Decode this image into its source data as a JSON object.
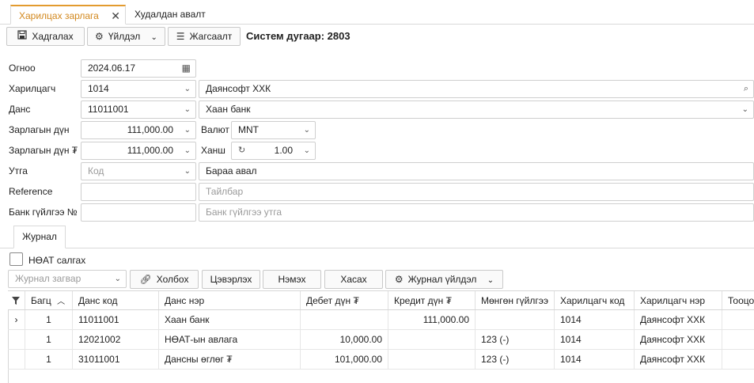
{
  "tabs": [
    {
      "label": "Харилцах зарлага",
      "active": true
    },
    {
      "label": "Худалдан авалт",
      "active": false
    }
  ],
  "toolbar": {
    "save_label": "Хадгалах",
    "action_label": "Үйлдэл",
    "list_label": "Жагсаалт",
    "system_number": "Систем дугаар: 2803"
  },
  "form": {
    "date_label": "Огноо",
    "date_value": "2024.06.17",
    "partner_label": "Харилцагч",
    "partner_code": "1014",
    "partner_name": "Даянсофт ХХК",
    "account_label": "Данс",
    "account_code": "11011001",
    "account_name": "Хаан банк",
    "amount_label": "Зарлагын дүн",
    "amount_value": "111,000.00",
    "currency_label": "Валют",
    "currency_value": "MNT",
    "amount_mnt_label": "Зарлагын дүн ₮",
    "amount_mnt_value": "111,000.00",
    "rate_label": "Ханш",
    "rate_value": "1.00",
    "purpose_label": "Утга",
    "purpose_code_placeholder": "Код",
    "purpose_value": "Бараа авал",
    "reference_label": "Reference",
    "reference_value": "",
    "note_placeholder": "Тайлбар",
    "bank_tx_label": "Банк гүйлгээ №",
    "bank_tx_value": "",
    "bank_tx_placeholder": "Банк гүйлгээ утга"
  },
  "journal": {
    "tab_label": "Журнал",
    "vat_checkbox_label": "НӨАТ салгах",
    "template_placeholder": "Журнал загвар",
    "link_label": "Холбох",
    "clear_label": "Цэвэрлэх",
    "add_label": "Нэмэх",
    "remove_label": "Хасах",
    "journal_action_label": "Журнал үйлдэл",
    "columns": [
      "Багц",
      "Данс код",
      "Данс нэр",
      "Дебет дүн ₮",
      "Кредит дүн ₮",
      "Мөнгөн гүйлгээ",
      "Харилцагч код",
      "Харилцагч нэр",
      "Тооцо"
    ],
    "rows": [
      {
        "batch": "1",
        "acc_code": "11011001",
        "acc_name": "Хаан банк",
        "debit": "",
        "credit": "111,000.00",
        "cash": "",
        "partner_code": "1014",
        "partner_name": "Даянсофт ХХК"
      },
      {
        "batch": "1",
        "acc_code": "12021002",
        "acc_name": "НӨАТ-ын авлага",
        "debit": "10,000.00",
        "credit": "",
        "cash": "123 (-)",
        "partner_code": "1014",
        "partner_name": "Даянсофт ХХК"
      },
      {
        "batch": "1",
        "acc_code": "31011001",
        "acc_name": "Дансны өглөг ₮",
        "debit": "101,000.00",
        "credit": "",
        "cash": "123 (-)",
        "partner_code": "1014",
        "partner_name": "Даянсофт ХХК"
      }
    ]
  },
  "colors": {
    "accent": "#d2881e",
    "accent_border": "#e39b2f",
    "border": "#cfcfcf"
  }
}
